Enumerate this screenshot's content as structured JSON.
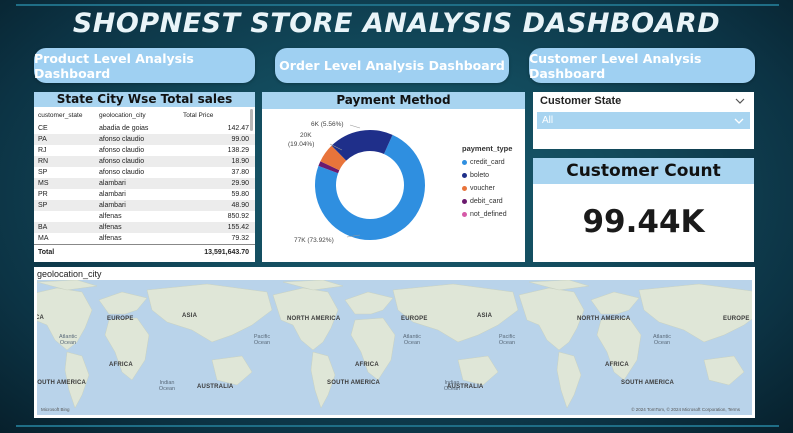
{
  "title": "SHOPNEST STORE ANALYSIS DASHBOARD",
  "nav": [
    {
      "label": "Product Level Analysis Dashboard"
    },
    {
      "label": "Order Level Analysis Dashboard"
    },
    {
      "label": "Customer Level Analysis Dashboard"
    }
  ],
  "sales_table": {
    "title": "State City Wse Total sales",
    "columns": [
      "customer_state",
      "geolocation_city",
      "Total Price"
    ],
    "rows": [
      [
        "CE",
        "abadia de goias",
        "142.47"
      ],
      [
        "PA",
        "afonso claudio",
        "99.00"
      ],
      [
        "RJ",
        "afonso claudio",
        "138.29"
      ],
      [
        "RN",
        "afonso claudio",
        "18.90"
      ],
      [
        "SP",
        "afonso claudio",
        "37.80"
      ],
      [
        "MS",
        "alambari",
        "29.90"
      ],
      [
        "PR",
        "alambari",
        "59.80"
      ],
      [
        "SP",
        "alambari",
        "48.90"
      ],
      [
        "",
        "alfenas",
        "850.92"
      ],
      [
        "BA",
        "alfenas",
        "155.42"
      ],
      [
        "MA",
        "alfenas",
        "79.32"
      ]
    ],
    "total_label": "Total",
    "total_value": "13,591,643.70"
  },
  "payment": {
    "title": "Payment Method",
    "legend_title": "payment_type",
    "labels": {
      "top1": "6K (5.56%)",
      "top2a": "20K",
      "top2b": "(19.04%)",
      "bottom": "77K (73.92%)"
    }
  },
  "chart_data": {
    "type": "pie",
    "title": "Payment Method",
    "legend_title": "payment_type",
    "categories": [
      "credit_card",
      "boleto",
      "voucher",
      "debit_card",
      "not_defined"
    ],
    "values": [
      73.92,
      19.04,
      5.56,
      1.48,
      0.0
    ],
    "colors": [
      "#2f8fe0",
      "#1f2f8a",
      "#e8743b",
      "#6b1a6e",
      "#d65aa8"
    ]
  },
  "filter": {
    "label": "Customer State",
    "value": "All"
  },
  "kpi": {
    "title": "Customer Count",
    "value": "99.44K"
  },
  "map": {
    "title": "geolocation_city",
    "continents": [
      "EUROPE",
      "ASIA",
      "NORTH AMERICA",
      "EUROPE",
      "ASIA",
      "NORTH AMERICA",
      "EUROPE",
      "AFRICA",
      "AFRICA",
      "AFRICA",
      "SOUTH AMERICA",
      "AUSTRALIA",
      "SOUTH AMERICA",
      "AUSTRALIA",
      "SOUTH AMERICA",
      "CA"
    ],
    "oceans": [
      "Atlantic Ocean",
      "Pacific Ocean",
      "Atlantic Ocean",
      "Pacific Ocean",
      "Atlantic Ocean",
      "Indian Ocean",
      "Indian Ocean"
    ],
    "attribution_left": "Microsoft Bing",
    "attribution_right": "© 2024 TomTom, © 2024 Microsoft Corporation, Terms"
  }
}
